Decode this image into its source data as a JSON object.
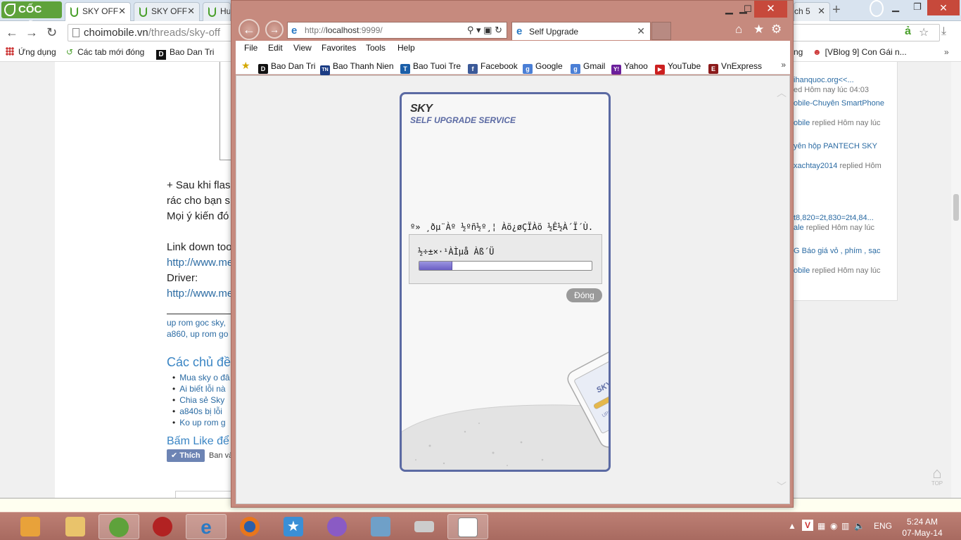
{
  "cococ": {
    "logo": "CỐC CỐC",
    "tabs": [
      {
        "label": "SKY OFF"
      },
      {
        "label": "SKY OFF"
      },
      {
        "label": "Hu"
      },
      {
        "label": "ch 5"
      }
    ],
    "address": {
      "domain": "choimobile.vn",
      "path": "/threads/sky-off"
    },
    "bookmarks": [
      {
        "label": "Ứng dụng"
      },
      {
        "label": "Các tab mới đóng"
      },
      {
        "label": "Bao Dan Tri"
      },
      {
        "label": "ng"
      },
      {
        "label": "[VBlog 9] Con Gái n..."
      }
    ]
  },
  "page": {
    "post_lines": [
      "+ Sau khi flas",
      "rác cho bạn s",
      "Mọi ý kiến đó",
      "Link down too",
      "http://www.me",
      "Driver:",
      "http://www.me"
    ],
    "tags": [
      "up rom goc sky,",
      "a860, up rom go"
    ],
    "related_title": "Các chủ đề",
    "related": [
      "Mua sky o đâ",
      "Ai biết lỗi nà",
      "Chia sẻ Sky",
      "a840s bị lỗi",
      "Ko up rom g"
    ],
    "like_text": "Bấm Like để",
    "like_button": "Thích",
    "like_after": "Ban và"
  },
  "sidebar": [
    {
      "text": "ihanquoc.org<<...",
      "gray": ""
    },
    {
      "text": "",
      "gray": "ed Hôm nay lúc 04:03"
    },
    {
      "text": "obile-Chuyên SmartPhone",
      "gray": ""
    },
    {
      "text": "obile",
      "gray": " replied Hôm nay lúc"
    },
    {
      "text": "yên hộp PANTECH SKY",
      "gray": ""
    },
    {
      "text": "xachtay2014",
      "gray": " replied Hôm"
    },
    {
      "text": "t8,820=2t,830=2t4,84...",
      "gray": ""
    },
    {
      "text": "ale",
      "gray": " replied Hôm nay lúc"
    },
    {
      "text": "G Báo giá vỏ , phím , sạc",
      "gray": ""
    },
    {
      "text": "obile",
      "gray": " replied Hôm nay lúc"
    }
  ],
  "top_button": "TOP",
  "ie": {
    "address": {
      "scheme": "http://",
      "host": "localhost",
      "rest": ":9999/"
    },
    "tab_title": "Self Upgrade",
    "menu": [
      "File",
      "Edit",
      "View",
      "Favorites",
      "Tools",
      "Help"
    ],
    "favorites": [
      {
        "label": "Bao Dan Tri",
        "icon": "D",
        "color": "#111111"
      },
      {
        "label": "Bao Thanh Nien",
        "icon": "TN",
        "color": "#1b3c84"
      },
      {
        "label": "Bao Tuoi Tre",
        "icon": "T",
        "color": "#1a5ea8"
      },
      {
        "label": "Facebook",
        "icon": "f",
        "color": "#3b5998"
      },
      {
        "label": "Google",
        "icon": "g",
        "color": "#4a7fd6"
      },
      {
        "label": "Gmail",
        "icon": "g",
        "color": "#4a7fd6"
      },
      {
        "label": "Yahoo",
        "icon": "Y!",
        "color": "#6b1f9b"
      },
      {
        "label": "YouTube",
        "icon": "▶",
        "color": "#cc2020"
      },
      {
        "label": "VnExpress",
        "icon": "E",
        "color": "#8b1a1a"
      }
    ]
  },
  "sky": {
    "brand": "SKY",
    "subtitle": "SELF UPGRADE SERVICE",
    "message": "º» ¸ðµ¨Àº ½ºñ½º¸¦ Àö¿øÇÏÀö ½Ê½À´Ï´Ù.",
    "status": "½÷±×·¹ÀÌµå Àß´Ü",
    "progress_percent": 19,
    "close_button": "Đóng",
    "phone_label": "SKY",
    "phone_label2": "UPGRADE"
  },
  "taskbar": {
    "lang": "ENG",
    "time": "5:24 AM",
    "date": "07-May-14"
  }
}
